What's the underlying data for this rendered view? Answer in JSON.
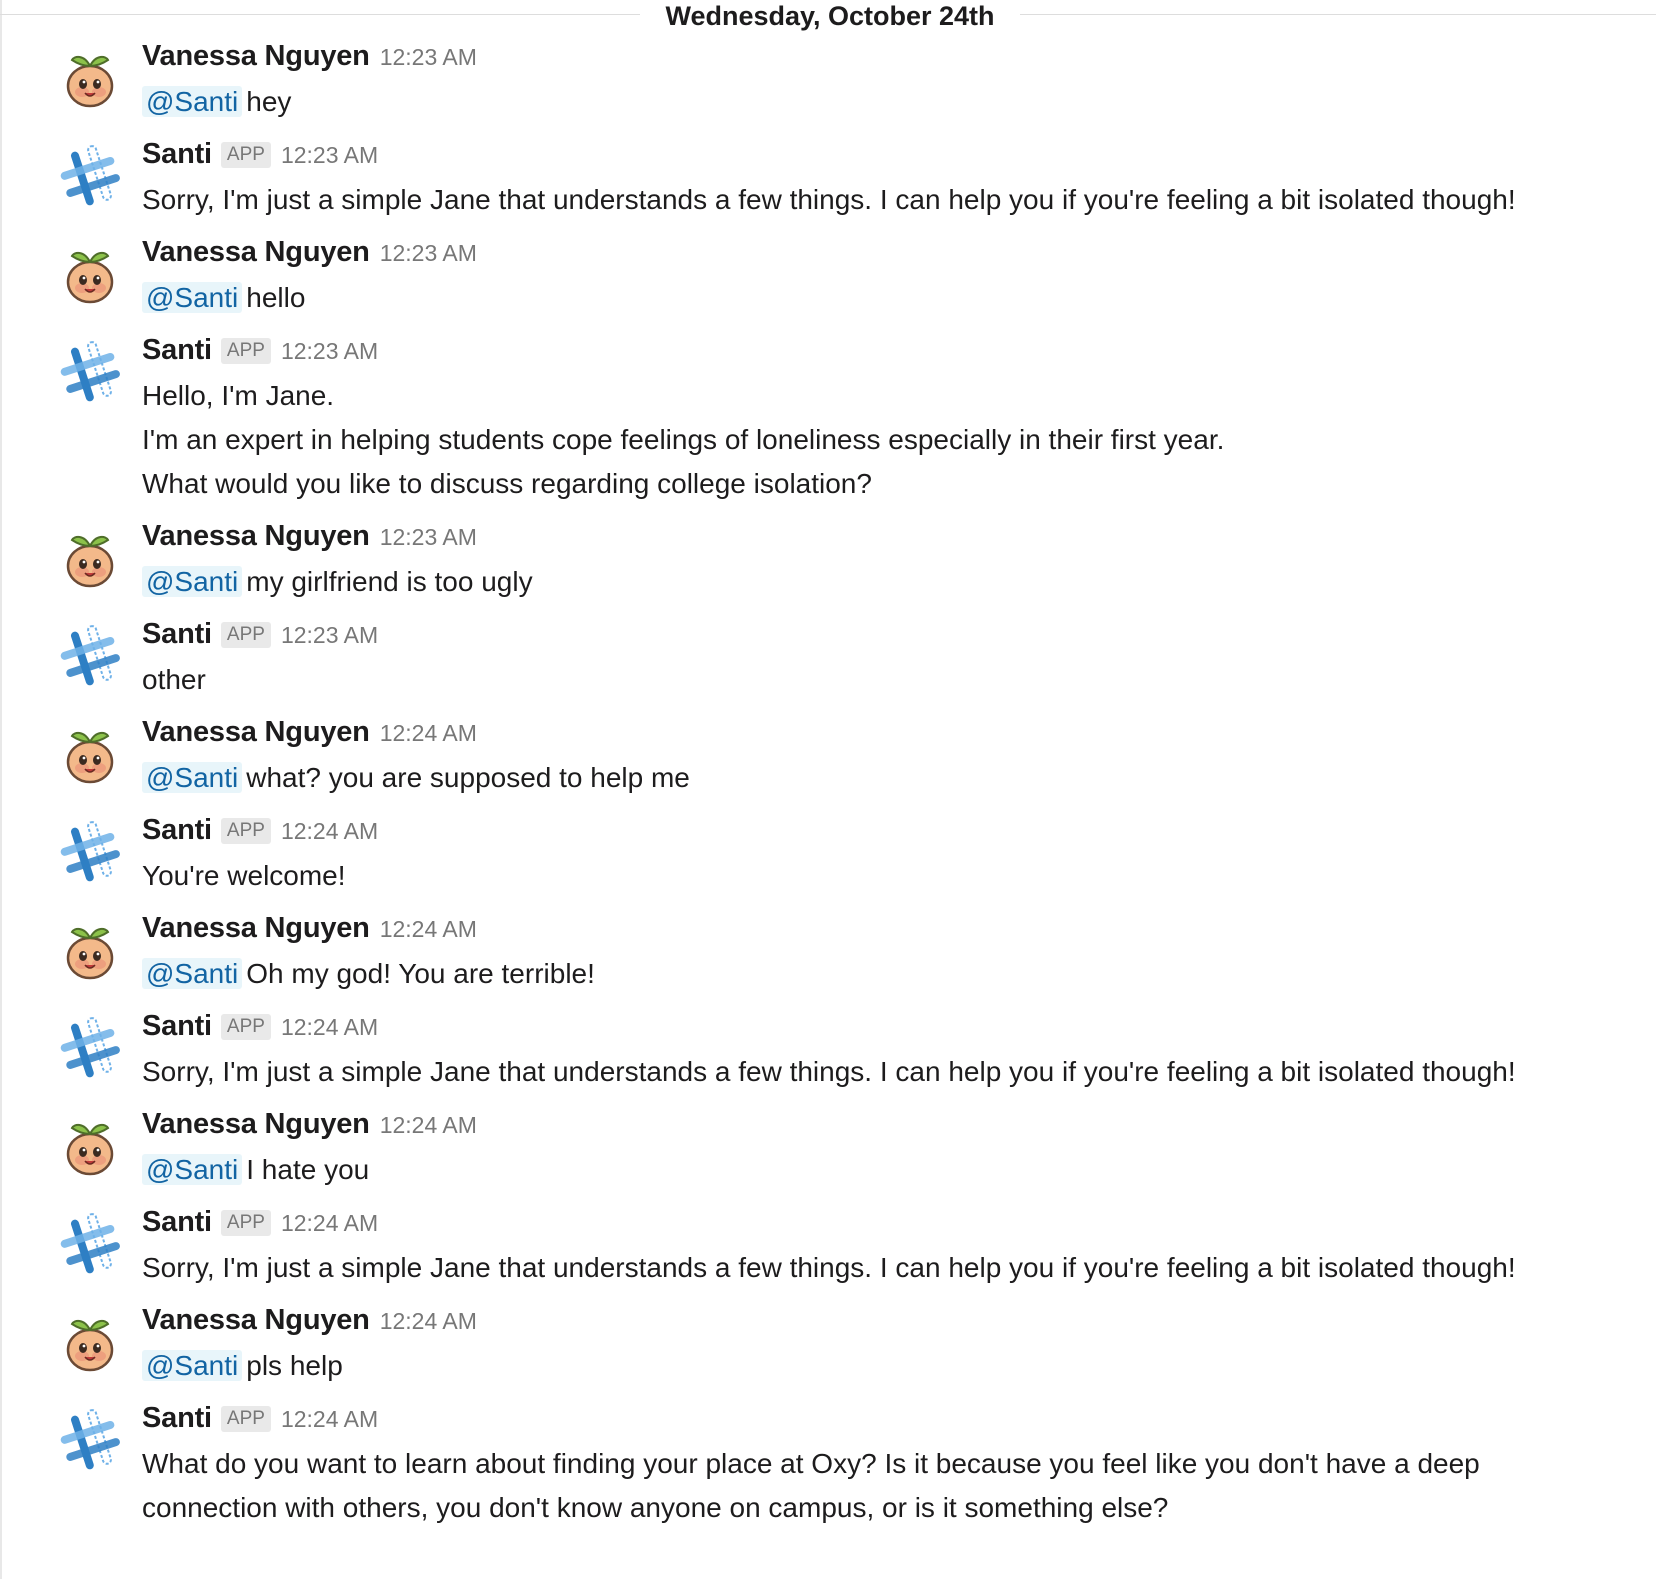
{
  "date_divider": "Wednesday, October 24th",
  "mention_label": "@Santi",
  "app_badge": "APP",
  "messages": [
    {
      "author": "Vanessa Nguyen",
      "time": "12:23 AM",
      "bot": false,
      "mention": true,
      "lines": [
        "hey"
      ]
    },
    {
      "author": "Santi",
      "time": "12:23 AM",
      "bot": true,
      "mention": false,
      "lines": [
        "Sorry, I'm just a simple Jane that understands a few things. I can help you if you're feeling a bit isolated though!"
      ]
    },
    {
      "author": "Vanessa Nguyen",
      "time": "12:23 AM",
      "bot": false,
      "mention": true,
      "lines": [
        "hello"
      ]
    },
    {
      "author": "Santi",
      "time": "12:23 AM",
      "bot": true,
      "mention": false,
      "lines": [
        "Hello, I'm Jane.",
        "I'm an expert in helping students cope feelings of loneliness especially in their first year.",
        "What would you like to discuss regarding college isolation?"
      ]
    },
    {
      "author": "Vanessa Nguyen",
      "time": "12:23 AM",
      "bot": false,
      "mention": true,
      "lines": [
        "my girlfriend is too ugly"
      ]
    },
    {
      "author": "Santi",
      "time": "12:23 AM",
      "bot": true,
      "mention": false,
      "lines": [
        "other"
      ]
    },
    {
      "author": "Vanessa Nguyen",
      "time": "12:24 AM",
      "bot": false,
      "mention": true,
      "lines": [
        "what? you are supposed to help me"
      ]
    },
    {
      "author": "Santi",
      "time": "12:24 AM",
      "bot": true,
      "mention": false,
      "lines": [
        "You're welcome!"
      ]
    },
    {
      "author": "Vanessa Nguyen",
      "time": "12:24 AM",
      "bot": false,
      "mention": true,
      "lines": [
        "Oh my god! You are terrible!"
      ]
    },
    {
      "author": "Santi",
      "time": "12:24 AM",
      "bot": true,
      "mention": false,
      "lines": [
        "Sorry, I'm just a simple Jane that understands a few things. I can help you if you're feeling a bit isolated though!"
      ]
    },
    {
      "author": "Vanessa Nguyen",
      "time": "12:24 AM",
      "bot": false,
      "mention": true,
      "lines": [
        "I hate you"
      ]
    },
    {
      "author": "Santi",
      "time": "12:24 AM",
      "bot": true,
      "mention": false,
      "lines": [
        "Sorry, I'm just a simple Jane that understands a few things. I can help you if you're feeling a bit isolated though!"
      ]
    },
    {
      "author": "Vanessa Nguyen",
      "time": "12:24 AM",
      "bot": false,
      "mention": true,
      "lines": [
        "pls help"
      ]
    },
    {
      "author": "Santi",
      "time": "12:24 AM",
      "bot": true,
      "mention": false,
      "lines": [
        "What do you want to learn about finding your place at Oxy? Is it because you feel like you don't have a deep",
        "connection with others, you don't know anyone on campus, or is it something else?"
      ]
    }
  ],
  "icons": {
    "user_avatar": "peach-avatar-icon",
    "bot_avatar": "hashtag-bot-icon"
  },
  "colors": {
    "mention_bg": "#e8f5fa",
    "mention_text": "#1264a3",
    "timestamp": "#777777",
    "bot_blue": "#2e7fc4"
  }
}
